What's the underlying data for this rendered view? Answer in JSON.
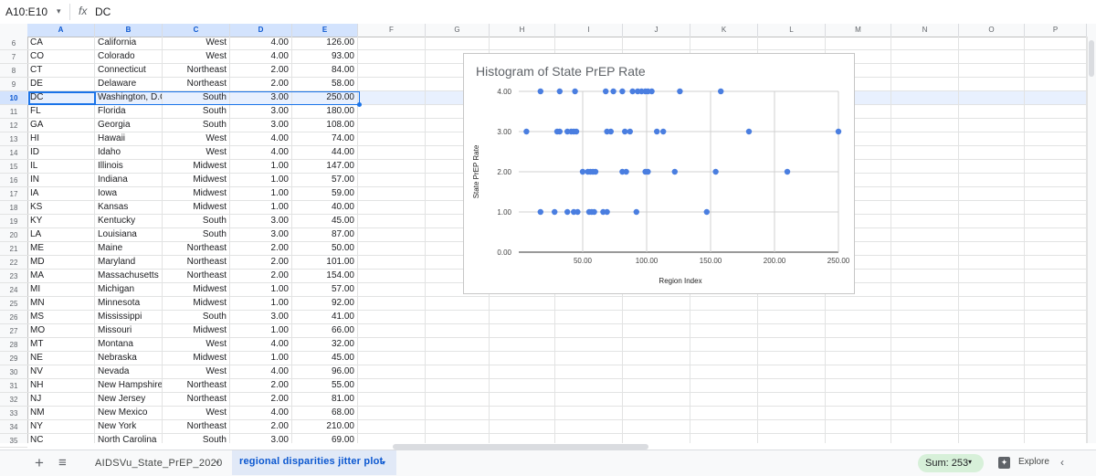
{
  "formula_bar": {
    "name_box": "A10:E10",
    "name_box_arrow": "▾",
    "fx": "fx",
    "value": "DC"
  },
  "columns": [
    "A",
    "B",
    "C",
    "D",
    "E",
    "F",
    "G",
    "H",
    "I",
    "J",
    "K",
    "L",
    "M",
    "N",
    "O",
    "P"
  ],
  "selected_row_number": "10",
  "rows": [
    {
      "n": "6",
      "a": "CA",
      "b": "California",
      "c": "West",
      "d": "4.00",
      "e": "126.00"
    },
    {
      "n": "7",
      "a": "CO",
      "b": "Colorado",
      "c": "West",
      "d": "4.00",
      "e": "93.00"
    },
    {
      "n": "8",
      "a": "CT",
      "b": "Connecticut",
      "c": "Northeast",
      "d": "2.00",
      "e": "84.00"
    },
    {
      "n": "9",
      "a": "DE",
      "b": "Delaware",
      "c": "Northeast",
      "d": "2.00",
      "e": "58.00"
    },
    {
      "n": "10",
      "a": "DC",
      "b": "Washington, D.C",
      "c": "South",
      "d": "3.00",
      "e": "250.00"
    },
    {
      "n": "11",
      "a": "FL",
      "b": "Florida",
      "c": "South",
      "d": "3.00",
      "e": "180.00"
    },
    {
      "n": "12",
      "a": "GA",
      "b": "Georgia",
      "c": "South",
      "d": "3.00",
      "e": "108.00"
    },
    {
      "n": "13",
      "a": "HI",
      "b": "Hawaii",
      "c": "West",
      "d": "4.00",
      "e": "74.00"
    },
    {
      "n": "14",
      "a": "ID",
      "b": "Idaho",
      "c": "West",
      "d": "4.00",
      "e": "44.00"
    },
    {
      "n": "15",
      "a": "IL",
      "b": "Illinois",
      "c": "Midwest",
      "d": "1.00",
      "e": "147.00"
    },
    {
      "n": "16",
      "a": "IN",
      "b": "Indiana",
      "c": "Midwest",
      "d": "1.00",
      "e": "57.00"
    },
    {
      "n": "17",
      "a": "IA",
      "b": "Iowa",
      "c": "Midwest",
      "d": "1.00",
      "e": "59.00"
    },
    {
      "n": "18",
      "a": "KS",
      "b": "Kansas",
      "c": "Midwest",
      "d": "1.00",
      "e": "40.00"
    },
    {
      "n": "19",
      "a": "KY",
      "b": "Kentucky",
      "c": "South",
      "d": "3.00",
      "e": "45.00"
    },
    {
      "n": "20",
      "a": "LA",
      "b": "Louisiana",
      "c": "South",
      "d": "3.00",
      "e": "87.00"
    },
    {
      "n": "21",
      "a": "ME",
      "b": "Maine",
      "c": "Northeast",
      "d": "2.00",
      "e": "50.00"
    },
    {
      "n": "22",
      "a": "MD",
      "b": "Maryland",
      "c": "Northeast",
      "d": "2.00",
      "e": "101.00"
    },
    {
      "n": "23",
      "a": "MA",
      "b": "Massachusetts",
      "c": "Northeast",
      "d": "2.00",
      "e": "154.00"
    },
    {
      "n": "24",
      "a": "MI",
      "b": "Michigan",
      "c": "Midwest",
      "d": "1.00",
      "e": "57.00"
    },
    {
      "n": "25",
      "a": "MN",
      "b": "Minnesota",
      "c": "Midwest",
      "d": "1.00",
      "e": "92.00"
    },
    {
      "n": "26",
      "a": "MS",
      "b": "Mississippi",
      "c": "South",
      "d": "3.00",
      "e": "41.00"
    },
    {
      "n": "27",
      "a": "MO",
      "b": "Missouri",
      "c": "Midwest",
      "d": "1.00",
      "e": "66.00"
    },
    {
      "n": "28",
      "a": "MT",
      "b": "Montana",
      "c": "West",
      "d": "4.00",
      "e": "32.00"
    },
    {
      "n": "29",
      "a": "NE",
      "b": "Nebraska",
      "c": "Midwest",
      "d": "1.00",
      "e": "45.00"
    },
    {
      "n": "30",
      "a": "NV",
      "b": "Nevada",
      "c": "West",
      "d": "4.00",
      "e": "96.00"
    },
    {
      "n": "31",
      "a": "NH",
      "b": "New Hampshire",
      "c": "Northeast",
      "d": "2.00",
      "e": "55.00"
    },
    {
      "n": "32",
      "a": "NJ",
      "b": "New Jersey",
      "c": "Northeast",
      "d": "2.00",
      "e": "81.00"
    },
    {
      "n": "33",
      "a": "NM",
      "b": "New Mexico",
      "c": "West",
      "d": "4.00",
      "e": "68.00"
    },
    {
      "n": "34",
      "a": "NY",
      "b": "New York",
      "c": "Northeast",
      "d": "2.00",
      "e": "210.00"
    },
    {
      "n": "35",
      "a": "NC",
      "b": "North Carolina",
      "c": "South",
      "d": "3.00",
      "e": "69.00"
    }
  ],
  "chart": {
    "title": "Histogram of State PrEP Rate",
    "xlabel": "Region Index",
    "ylabel": "State PrEP Rate",
    "x_ticks": [
      "50.00",
      "100.00",
      "150.00",
      "200.00",
      "250.00"
    ],
    "y_ticks": [
      "0.00",
      "1.00",
      "2.00",
      "3.00",
      "4.00"
    ],
    "dot_color": "#4a7ee0"
  },
  "chart_data": {
    "type": "scatter",
    "title": "Histogram of State PrEP Rate",
    "xlabel": "Region Index",
    "ylabel": "State PrEP Rate",
    "xlim": [
      0,
      250
    ],
    "ylim": [
      0,
      4
    ],
    "grid": true,
    "points": [
      {
        "x": 17,
        "y": 4
      },
      {
        "x": 32,
        "y": 4
      },
      {
        "x": 44,
        "y": 4
      },
      {
        "x": 68,
        "y": 4
      },
      {
        "x": 74,
        "y": 4
      },
      {
        "x": 81,
        "y": 4
      },
      {
        "x": 89,
        "y": 4
      },
      {
        "x": 93,
        "y": 4
      },
      {
        "x": 96,
        "y": 4
      },
      {
        "x": 99,
        "y": 4
      },
      {
        "x": 101,
        "y": 4
      },
      {
        "x": 104,
        "y": 4
      },
      {
        "x": 126,
        "y": 4
      },
      {
        "x": 158,
        "y": 4
      },
      {
        "x": 6,
        "y": 3
      },
      {
        "x": 30,
        "y": 3
      },
      {
        "x": 32,
        "y": 3
      },
      {
        "x": 38,
        "y": 3
      },
      {
        "x": 41,
        "y": 3
      },
      {
        "x": 43,
        "y": 3
      },
      {
        "x": 45,
        "y": 3
      },
      {
        "x": 69,
        "y": 3
      },
      {
        "x": 72,
        "y": 3
      },
      {
        "x": 83,
        "y": 3
      },
      {
        "x": 87,
        "y": 3
      },
      {
        "x": 108,
        "y": 3
      },
      {
        "x": 113,
        "y": 3
      },
      {
        "x": 180,
        "y": 3
      },
      {
        "x": 250,
        "y": 3
      },
      {
        "x": 50,
        "y": 2
      },
      {
        "x": 54,
        "y": 2
      },
      {
        "x": 56,
        "y": 2
      },
      {
        "x": 58,
        "y": 2
      },
      {
        "x": 60,
        "y": 2
      },
      {
        "x": 81,
        "y": 2
      },
      {
        "x": 84,
        "y": 2
      },
      {
        "x": 99,
        "y": 2
      },
      {
        "x": 101,
        "y": 2
      },
      {
        "x": 122,
        "y": 2
      },
      {
        "x": 154,
        "y": 2
      },
      {
        "x": 210,
        "y": 2
      },
      {
        "x": 17,
        "y": 1
      },
      {
        "x": 28,
        "y": 1
      },
      {
        "x": 38,
        "y": 1
      },
      {
        "x": 43,
        "y": 1
      },
      {
        "x": 46,
        "y": 1
      },
      {
        "x": 55,
        "y": 1
      },
      {
        "x": 57,
        "y": 1
      },
      {
        "x": 59,
        "y": 1
      },
      {
        "x": 66,
        "y": 1
      },
      {
        "x": 69,
        "y": 1
      },
      {
        "x": 92,
        "y": 1
      },
      {
        "x": 147,
        "y": 1
      }
    ]
  },
  "sheets": {
    "add_icon": "+",
    "all_sheets_icon": "≡",
    "tab1": "AIDSVu_State_PrEP_2020",
    "tab2": "regional disparities jitter plot",
    "arrow": "▾"
  },
  "status": {
    "sum": "Sum: 253",
    "explore": "Explore",
    "collapse": "‹"
  }
}
